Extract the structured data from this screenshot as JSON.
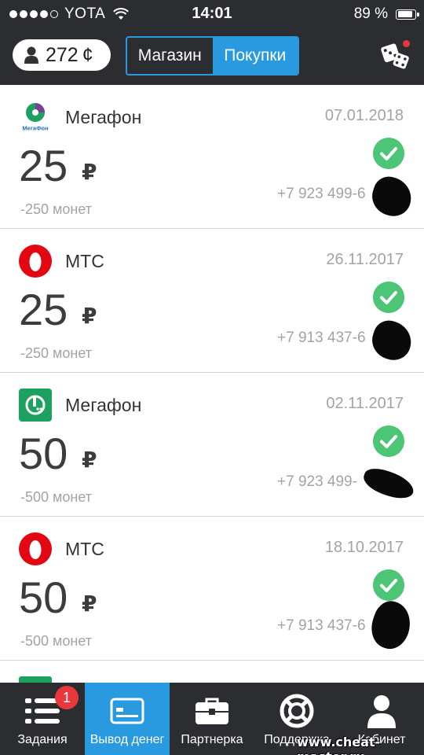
{
  "status_bar": {
    "carrier": "YOTA",
    "time": "14:01",
    "battery": "89 %",
    "battery_level": 0.89,
    "signal_bars": 4
  },
  "top_bar": {
    "balance": "272",
    "coin_symbol": "¢",
    "segments": [
      {
        "label": "Магазин",
        "active": false
      },
      {
        "label": "Покупки",
        "active": true
      }
    ],
    "dice_icon": "dice-icon",
    "notification_dot_color": "#e8383d"
  },
  "purchases": [
    {
      "operator": "Мегафон",
      "logo": "megafon-round-logo",
      "date": "07.01.2018",
      "amount": "25",
      "currency": "₽",
      "coins": "-250 монет",
      "phone": "+7 923 499-6",
      "status_icon": "check-icon"
    },
    {
      "operator": "МТС",
      "logo": "mts-egg-logo",
      "date": "26.11.2017",
      "amount": "25",
      "currency": "₽",
      "coins": "-250 монет",
      "phone": "+7 913 437-6",
      "status_icon": "check-icon"
    },
    {
      "operator": "Мегафон",
      "logo": "megafon-square-logo",
      "date": "02.11.2017",
      "amount": "50",
      "currency": "₽",
      "coins": "-500 монет",
      "phone": "+7 923 499-",
      "status_icon": "check-icon"
    },
    {
      "operator": "МТС",
      "logo": "mts-egg-logo",
      "date": "18.10.2017",
      "amount": "50",
      "currency": "₽",
      "coins": "-500 монет",
      "phone": "+7 913 437-6",
      "status_icon": "check-icon"
    }
  ],
  "tabs": [
    {
      "label": "Задания",
      "icon": "list-icon",
      "badge": "1",
      "active": false
    },
    {
      "label": "Вывод денег",
      "icon": "card-icon",
      "active": true
    },
    {
      "label": "Партнерка",
      "icon": "briefcase-icon",
      "active": false
    },
    {
      "label": "Поддержка",
      "icon": "lifebuoy-icon",
      "active": false
    },
    {
      "label": "Кабинет",
      "icon": "user-icon",
      "active": false
    }
  ],
  "watermark": "www.cheat-master.ru",
  "colors": {
    "header_bg": "#2c2d31",
    "accent_blue": "#2a9ae0",
    "success_green": "#4cc576",
    "badge_red": "#e8383d",
    "mts_red": "#e30613",
    "megafon_green": "#1da160"
  }
}
